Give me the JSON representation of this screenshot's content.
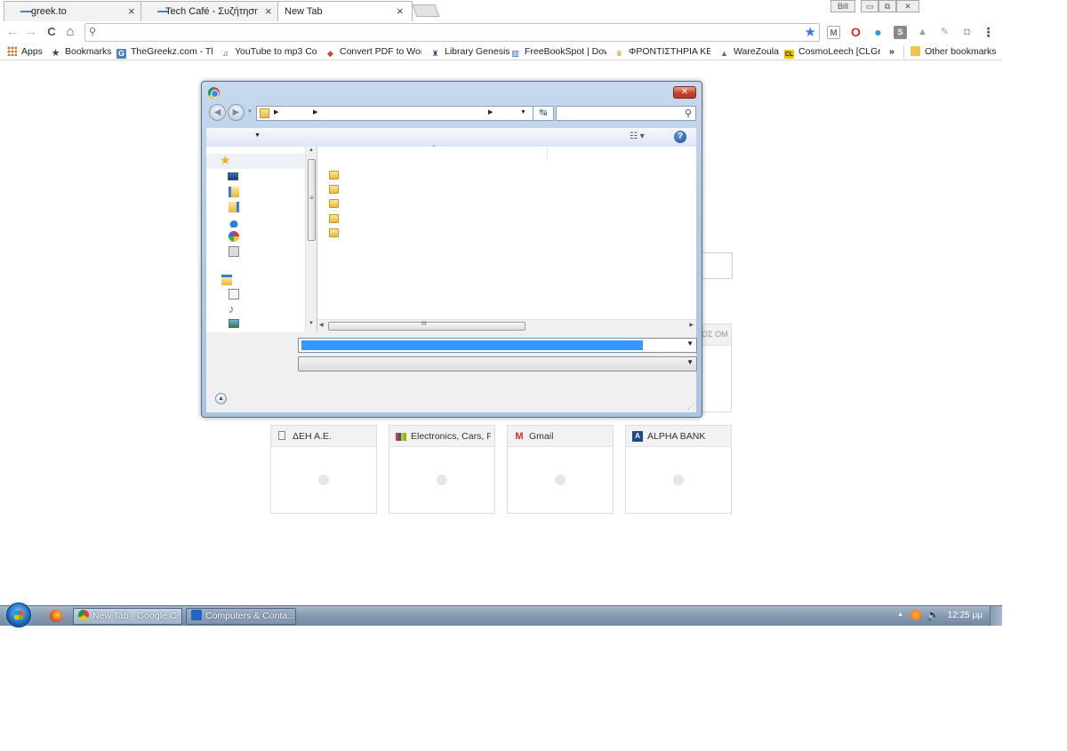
{
  "browser": {
    "tabs": [
      {
        "title": "greek.to",
        "close": "×"
      },
      {
        "title": "Tech Café - Συζήτηση πε",
        "close": "×"
      },
      {
        "title": "New Tab",
        "close": "×"
      }
    ],
    "window_controls": {
      "user": "Bill",
      "minimize": "▭",
      "maximize": "⧉",
      "close": "✕"
    },
    "nav": {
      "back": "←",
      "forward": "→",
      "reload": "C",
      "home": "⌂"
    },
    "omnibox": {
      "value": "",
      "search_glyph": "⚲",
      "star_glyph": "★"
    },
    "extensions": [
      {
        "name": "gmail-checker-icon",
        "glyph": "M",
        "color": "#777777",
        "bg": "#ffffff"
      },
      {
        "name": "opera-icon",
        "glyph": "O",
        "color": "#e32a26",
        "bg": "#ffffff"
      },
      {
        "name": "blue-extension-icon",
        "glyph": "●",
        "color": "#1aa1e0",
        "bg": "#ffffff"
      },
      {
        "name": "grey-extension-icon",
        "glyph": "S",
        "color": "#ffffff",
        "bg": "#8a8a8a"
      },
      {
        "name": "drive-icon",
        "glyph": "▲",
        "color": "#9a9a9a",
        "bg": "#ffffff"
      },
      {
        "name": "pencil-extension-icon",
        "glyph": "✎",
        "color": "#9a9a9a",
        "bg": "#ffffff"
      },
      {
        "name": "camera-extension-icon",
        "glyph": "◘",
        "color": "#9a9a9a",
        "bg": "#ffffff"
      },
      {
        "name": "menu-icon",
        "glyph": "⋮",
        "color": "#444444",
        "bg": "#ffffff"
      }
    ],
    "bookmarks": [
      {
        "label": "Apps",
        "icon": "apps-grid-icon",
        "glyph": "⋮⋮",
        "color": "#e56b1f"
      },
      {
        "label": "Bookmarks",
        "icon": "star-icon",
        "glyph": "★",
        "color": "#444444"
      },
      {
        "label": "TheGreekz.com - The",
        "icon": "thegreekz-icon",
        "glyph": "G",
        "color": "#4a80c4"
      },
      {
        "label": "YouTube to mp3 Con",
        "icon": "youtube-mp3-icon",
        "glyph": "♫",
        "color": "#4a5a8a"
      },
      {
        "label": "Convert PDF to Word",
        "icon": "pdf-icon",
        "glyph": "◆",
        "color": "#c5412a"
      },
      {
        "label": "Library Genesis",
        "icon": "library-genesis-icon",
        "glyph": "♜",
        "color": "#3d4d7a"
      },
      {
        "label": "FreeBookSpot | Down",
        "icon": "book-icon",
        "glyph": "▥",
        "color": "#2f62b2"
      },
      {
        "label": "ΦΡΟΝΤΙΣΤΗΡΙΑ ΚΕΛΑ",
        "icon": "school-icon",
        "glyph": "♛",
        "color": "#c9a23a"
      },
      {
        "label": "WareZoula",
        "icon": "warezoula-icon",
        "glyph": "▲",
        "color": "#3c8a3a"
      },
      {
        "label": "CosmoLeech [CLGrTe",
        "icon": "cosmoleech-icon",
        "glyph": "CL",
        "color": "#e8c400"
      },
      {
        "label": "»",
        "icon": "more-bookmarks-icon",
        "glyph": "",
        "color": "#444444"
      },
      {
        "label": "Other bookmarks",
        "icon": "folder-icon",
        "glyph": "▰",
        "color": "#f0c450"
      }
    ]
  },
  "ntp": {
    "tiles": [
      {
        "title": "ΔΕΗ Α.Ε.",
        "icon": "document-icon",
        "glyph": "▯",
        "color": "#888888"
      },
      {
        "title": "Electronics, Cars, Fas",
        "icon": "ebay-icon",
        "glyph": "▮",
        "color": "#e53238"
      },
      {
        "title": "Gmail",
        "icon": "gmail-icon",
        "glyph": "M",
        "color": "#d93025"
      },
      {
        "title": "ALPHA BANK",
        "icon": "alpha-bank-icon",
        "glyph": "A",
        "color": "#1f4a8a"
      }
    ],
    "hidden_tile_title": "ΟΣ ΟΜ"
  },
  "dialog": {
    "close": "✕",
    "nav_back": "◀",
    "nav_forward": "▶",
    "path_arrows": [
      "▶",
      "▶",
      "▶"
    ],
    "refresh_glyph": "↹",
    "search_glyph": "⚲",
    "organize_arrow": "▼",
    "view_glyph": "☷ ▾",
    "help_glyph": "?",
    "sort_glyph": "⌃",
    "nav_favorites_glyph": "★",
    "hide_folders_glyph": "▲",
    "resize_glyph": "⋰",
    "combo_arrow": "▼",
    "scroll_up": "▲",
    "scroll_down": "▼",
    "scroll_left": "◀",
    "scroll_right": "▶",
    "scroll_grip": "≡",
    "hscroll_grip": "III"
  },
  "taskbar": {
    "buttons": [
      {
        "label": "New Tab - Google C...",
        "icon": "chrome-icon"
      },
      {
        "label": "Computers & Conta...",
        "icon": "teamviewer-icon"
      }
    ],
    "tray_arrow": "▲",
    "clock": "12:25 μμ"
  }
}
